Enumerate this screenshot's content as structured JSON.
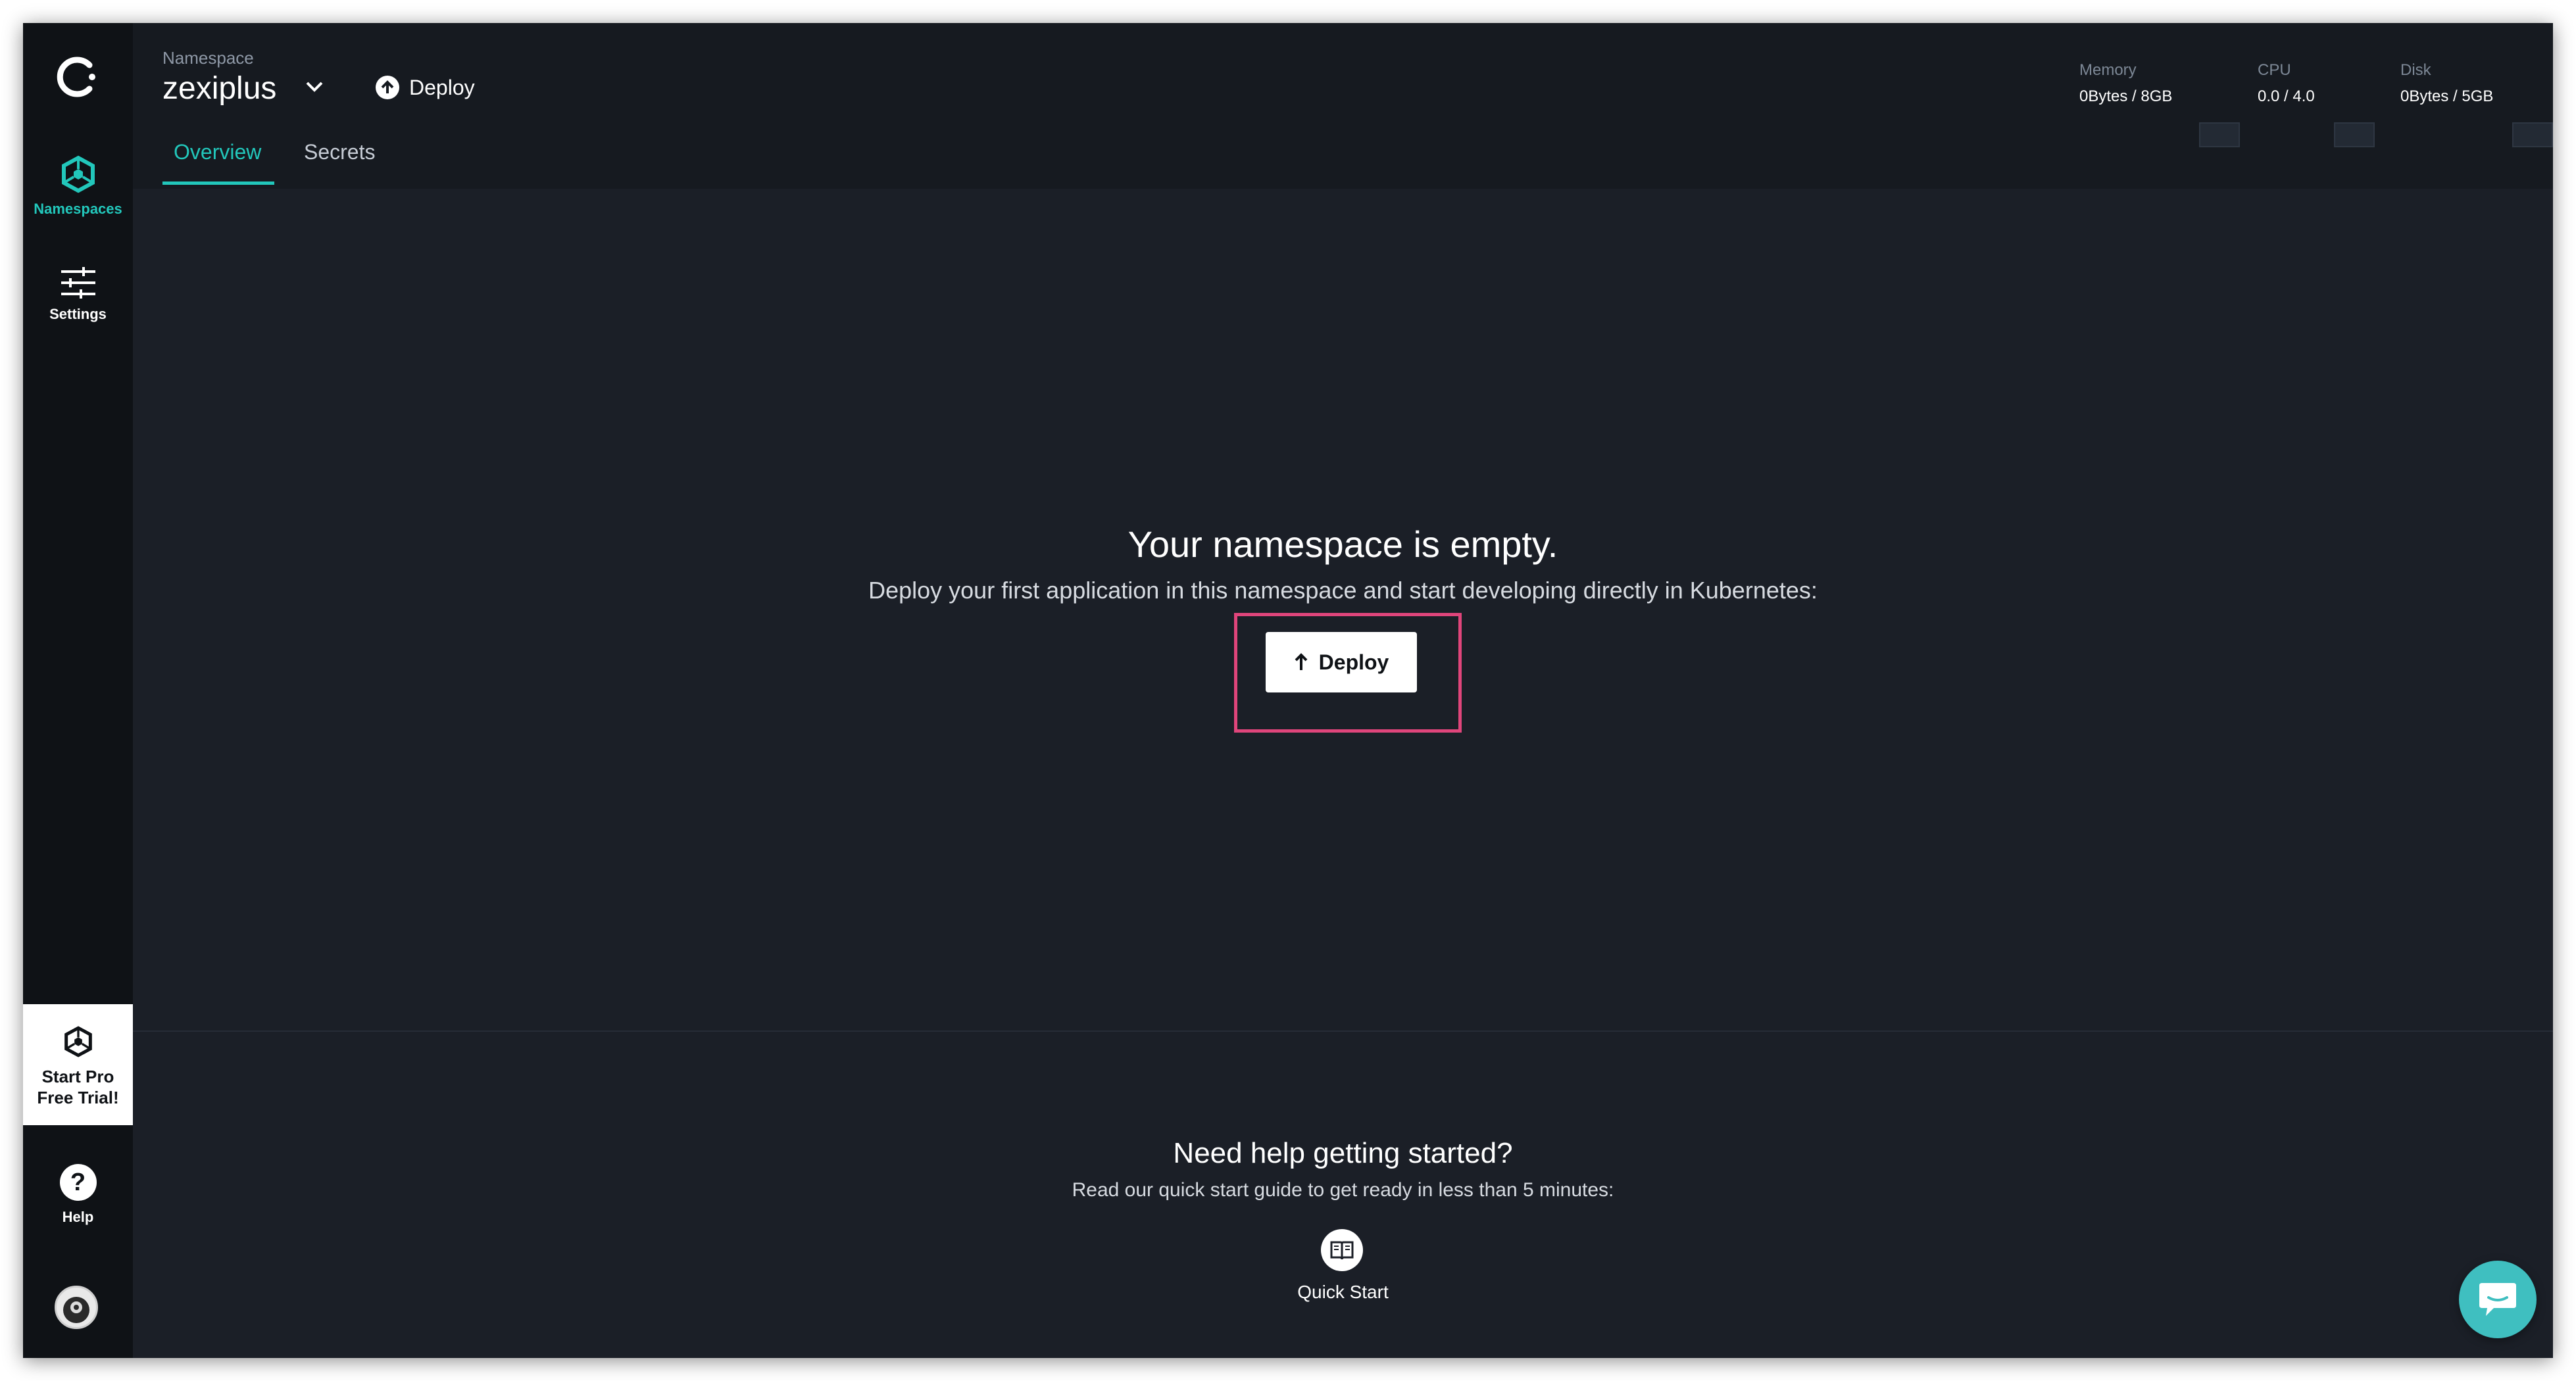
{
  "app": {
    "accent_color": "#22c7bb",
    "highlight_color": "#e0457b"
  },
  "sidebar": {
    "items": [
      {
        "label": "Namespaces",
        "icon": "namespaces-icon",
        "active": true
      },
      {
        "label": "Settings",
        "icon": "sliders-icon",
        "active": false
      }
    ],
    "pro_trial": {
      "line1": "Start Pro",
      "line2": "Free Trial!"
    },
    "help": {
      "label": "Help",
      "glyph": "?"
    }
  },
  "header": {
    "namespace_caption": "Namespace",
    "namespace_name": "zexiplus",
    "deploy_label": "Deploy",
    "tabs": [
      {
        "label": "Overview",
        "active": true
      },
      {
        "label": "Secrets",
        "active": false
      }
    ],
    "metrics": {
      "memory": {
        "label": "Memory",
        "value": "0Bytes / 8GB"
      },
      "cpu": {
        "label": "CPU",
        "value": "0.0 / 4.0"
      },
      "disk": {
        "label": "Disk",
        "value": "0Bytes / 5GB"
      }
    }
  },
  "main": {
    "empty_title": "Your namespace is empty.",
    "empty_subtitle": "Deploy your first application in this namespace and start developing directly in Kubernetes:",
    "deploy_button": "Deploy"
  },
  "help_section": {
    "title": "Need help getting started?",
    "subtitle": "Read our quick start guide to get ready in less than 5 minutes:",
    "quick_start_label": "Quick Start"
  }
}
